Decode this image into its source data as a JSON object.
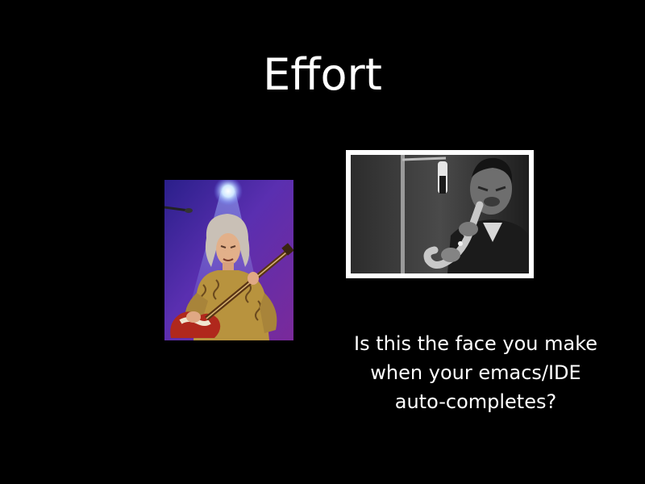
{
  "slide": {
    "title": "Effort",
    "caption_lines": [
      "Is this the face you make",
      "when your emacs/IDE",
      "auto-completes?"
    ],
    "images": [
      {
        "name": "guitarist-photo",
        "kind": "color photograph"
      },
      {
        "name": "saxophonist-photo",
        "kind": "black-and-white photograph"
      }
    ],
    "colors": {
      "background": "#000000",
      "text": "#ffffff"
    }
  }
}
